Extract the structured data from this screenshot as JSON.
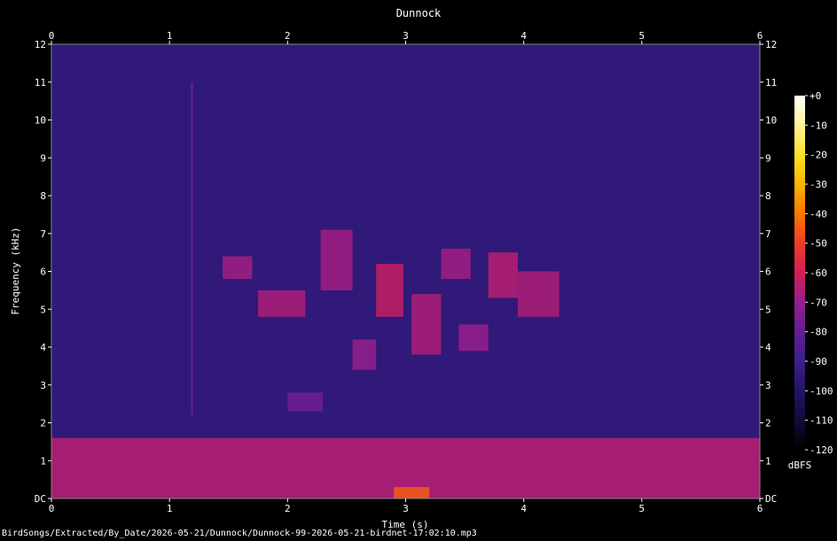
{
  "chart_data": {
    "type": "heatmap",
    "title": "Dunnock",
    "xlabel": "Time (s)",
    "ylabel": "Frequency (kHz)",
    "xlim": [
      0,
      6
    ],
    "ylim": [
      0,
      12
    ],
    "x_ticks": [
      "0",
      "1",
      "2",
      "3",
      "4",
      "5",
      "6"
    ],
    "y_ticks": [
      "DC",
      "1",
      "2",
      "3",
      "4",
      "5",
      "6",
      "7",
      "8",
      "9",
      "10",
      "11",
      "12"
    ],
    "colorbar": {
      "label": "dBFS",
      "range": [
        -120,
        0
      ],
      "ticks": [
        "+0",
        "-10",
        "-20",
        "-30",
        "-40",
        "-50",
        "-60",
        "-70",
        "-80",
        "-90",
        "-100",
        "-110",
        "-120"
      ]
    },
    "background_level_dbfs": -95,
    "low_band": {
      "f_range_khz": [
        0,
        1.6
      ],
      "level_dbfs": -65
    },
    "song_events": [
      {
        "t": [
          1.18,
          1.2
        ],
        "f": [
          2.2,
          11.0
        ],
        "level_dbfs": -80
      },
      {
        "t": [
          1.45,
          1.7
        ],
        "f": [
          5.8,
          6.4
        ],
        "level_dbfs": -68
      },
      {
        "t": [
          1.75,
          2.15
        ],
        "f": [
          4.8,
          5.5
        ],
        "level_dbfs": -66
      },
      {
        "t": [
          2.28,
          2.55
        ],
        "f": [
          5.5,
          7.1
        ],
        "level_dbfs": -68
      },
      {
        "t": [
          2.55,
          2.75
        ],
        "f": [
          3.4,
          4.2
        ],
        "level_dbfs": -70
      },
      {
        "t": [
          2.75,
          2.98
        ],
        "f": [
          4.8,
          6.2
        ],
        "level_dbfs": -62
      },
      {
        "t": [
          3.05,
          3.3
        ],
        "f": [
          3.8,
          5.4
        ],
        "level_dbfs": -66
      },
      {
        "t": [
          3.3,
          3.55
        ],
        "f": [
          5.8,
          6.6
        ],
        "level_dbfs": -68
      },
      {
        "t": [
          3.45,
          3.7
        ],
        "f": [
          3.9,
          4.6
        ],
        "level_dbfs": -70
      },
      {
        "t": [
          3.7,
          3.95
        ],
        "f": [
          5.3,
          6.5
        ],
        "level_dbfs": -64
      },
      {
        "t": [
          3.95,
          4.3
        ],
        "f": [
          4.8,
          6.0
        ],
        "level_dbfs": -66
      },
      {
        "t": [
          2.0,
          2.3
        ],
        "f": [
          2.3,
          2.8
        ],
        "level_dbfs": -78
      },
      {
        "t": [
          2.9,
          3.2
        ],
        "f": [
          0.0,
          0.3
        ],
        "level_dbfs": -45
      }
    ],
    "grid": false,
    "legend": "colorbar-right"
  },
  "footer_path": "BirdSongs/Extracted/By_Date/2026-05-21/Dunnock/Dunnock-99-2026-05-21-birdnet-17:02:10.mp3"
}
